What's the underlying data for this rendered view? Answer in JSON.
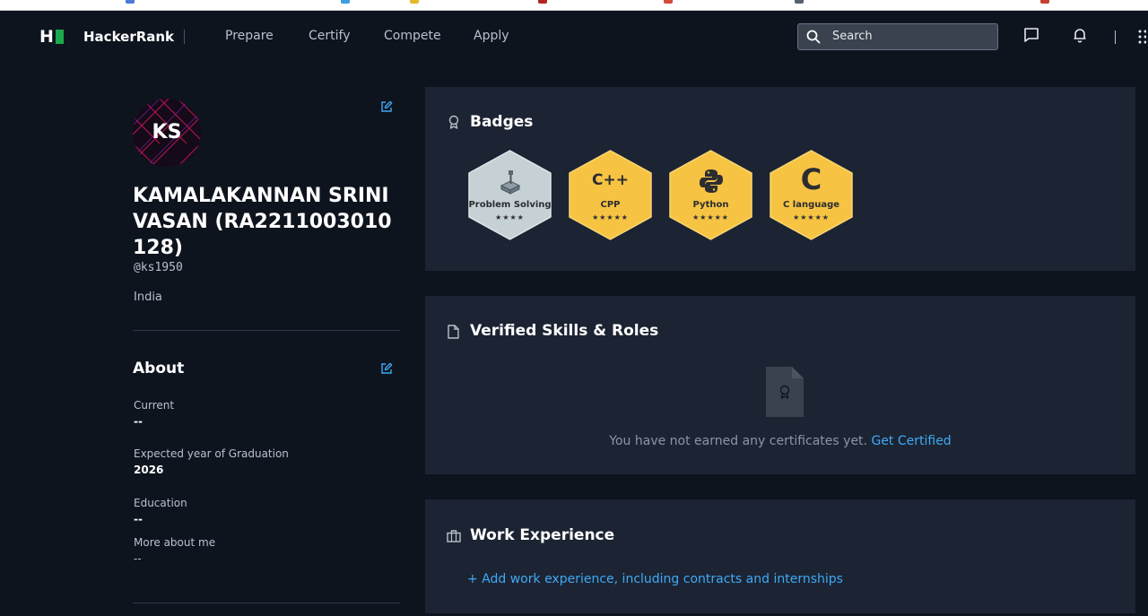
{
  "nav": {
    "brand": "HackerRank",
    "logo_letter": "H",
    "links": [
      "Prepare",
      "Certify",
      "Compete",
      "Apply"
    ],
    "search_placeholder": "Search"
  },
  "profile": {
    "initials": "KS",
    "name": "KAMALAKANNAN SRINIVASAN (RA2211003010128)",
    "handle": "@ks1950",
    "country": "India"
  },
  "about": {
    "title": "About",
    "fields": [
      {
        "label": "Current",
        "value": "--"
      },
      {
        "label": "Expected year of Graduation",
        "value": "2026"
      },
      {
        "label": "Education",
        "value": "--"
      },
      {
        "label": "More about me",
        "value": "--"
      }
    ]
  },
  "badges": {
    "title": "Badges",
    "items": [
      {
        "name": "Problem Solving",
        "stars": "★★★★",
        "icon": "C++",
        "color": "#c6d1d6"
      },
      {
        "name": "CPP",
        "stars": "★★★★★",
        "icon": "C++",
        "color": "#f6c343"
      },
      {
        "name": "Python",
        "stars": "★★★★★",
        "icon": "python-icon",
        "color": "#f6c343"
      },
      {
        "name": "C language",
        "stars": "★★★★★",
        "icon": "C",
        "color": "#f6c343"
      }
    ]
  },
  "verified": {
    "title": "Verified Skills & Roles",
    "empty_text": "You have not earned any certificates yet.",
    "cta": "Get Certified"
  },
  "work": {
    "title": "Work Experience",
    "add_link": "+ Add work experience, including contracts and internships"
  },
  "colors": {
    "background": "#0e141e",
    "card": "#1c2433",
    "accent_green": "#1ba94c",
    "link_blue": "#3fa9f5",
    "gold_badge": "#f6c343",
    "silver_badge": "#c6d1d6"
  }
}
